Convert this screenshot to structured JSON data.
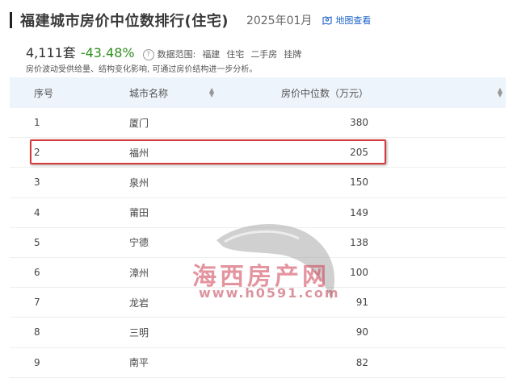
{
  "header": {
    "title": "福建城市房价中位数排行(住宅)",
    "date": "2025年01月",
    "map_link": "地图查看"
  },
  "stats": {
    "count": "4,111套",
    "change": "-43.48%",
    "scope_label": "数据范围:",
    "scope_items": [
      "福建",
      "住宅",
      "二手房",
      "挂牌"
    ]
  },
  "note": "房价波动受供给量、结构变化影响, 可通过房价结构进一步分析。",
  "table": {
    "headers": {
      "index": "序号",
      "city": "城市名称",
      "price": "房价中位数（万元）"
    },
    "rows": [
      {
        "index": "1",
        "city": "厦门",
        "price": "380"
      },
      {
        "index": "2",
        "city": "福州",
        "price": "205"
      },
      {
        "index": "3",
        "city": "泉州",
        "price": "150"
      },
      {
        "index": "4",
        "city": "莆田",
        "price": "149"
      },
      {
        "index": "5",
        "city": "宁德",
        "price": "138"
      },
      {
        "index": "6",
        "city": "漳州",
        "price": "100"
      },
      {
        "index": "7",
        "city": "龙岩",
        "price": "91"
      },
      {
        "index": "8",
        "city": "三明",
        "price": "90"
      },
      {
        "index": "9",
        "city": "南平",
        "price": "82"
      }
    ]
  },
  "watermark": {
    "name": "海西房产网",
    "url": "www.h0591.com"
  },
  "colors": {
    "accent_blue": "#1e63c8",
    "change_green": "#2f8f1f",
    "highlight_red": "#d63a3a",
    "header_bg": "#eef4fb"
  }
}
